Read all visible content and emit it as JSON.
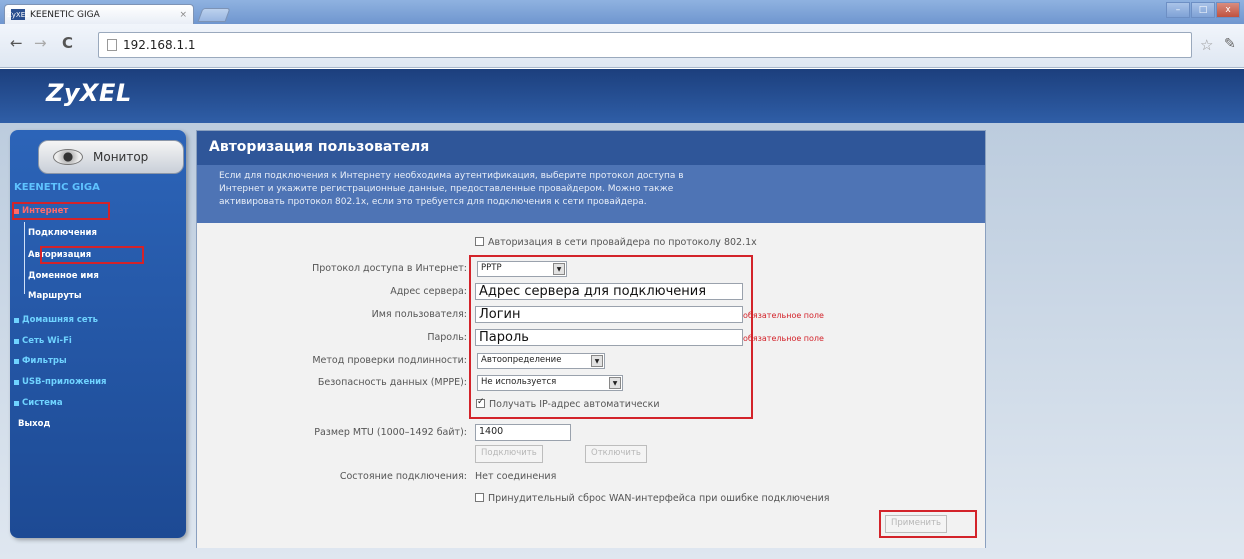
{
  "browser": {
    "tab_title": "KEENETIC GIGA",
    "tab_favicon": "ZyXEL",
    "tab_close": "×",
    "address": "192.168.1.1",
    "win_minimize": "–",
    "win_maximize": "□",
    "win_close": "x"
  },
  "router": {
    "logo": "ZyXEL",
    "monitor_label": "Монитор",
    "device_title": "KEENETIC GIGA",
    "menu": {
      "internet": "Интернет",
      "sub": [
        "Подключения",
        "Авторизация",
        "Доменное имя",
        "Маршруты"
      ],
      "home_network": "Домашняя сеть",
      "wifi": "Сеть Wi-Fi",
      "filters": "Фильтры",
      "usb": "USB-приложения",
      "system": "Система",
      "exit": "Выход"
    }
  },
  "content": {
    "title": "Авторизация пользователя",
    "description": [
      "Если для подключения к Интернету необходима аутентификация, выберите протокол доступа в",
      "Интернет и укажите регистрационные данные, предоставленные провайдером. Можно также",
      "активировать протокол 802.1x, если это требуется для подключения к сети провайдера."
    ],
    "checkbox_8021x": "Авторизация в сети провайдера по протоколу 802.1x",
    "fields": {
      "protocol_label": "Протокол доступа в Интернет:",
      "protocol_value": "PPTP",
      "server_label": "Адрес сервера:",
      "server_value": "Адрес сервера для подключения",
      "username_label": "Имя пользователя:",
      "username_value": "Логин",
      "password_label": "Пароль:",
      "password_value": "Пароль",
      "required_note": "обязательное поле",
      "auth_method_label": "Метод проверки подлинности:",
      "auth_method_value": "Автоопределение",
      "security_label": "Безопасность данных (MPPE):",
      "security_value": "Не используется",
      "auto_ip": "Получать IP-адрес автоматически",
      "mtu_label": "Размер MTU (1000–1492 байт):",
      "mtu_value": "1400",
      "connect_button": "Подключить",
      "disconnect_button": "Отключить",
      "status_label": "Состояние подключения:",
      "status_value": "Нет соединения",
      "force_reset": "Принудительный сброс WAN-интерфейса при ошибке подключения",
      "apply_button": "Применить"
    }
  },
  "colors": {
    "header_bg": "#1c3f7d",
    "sidebar_bg": "#2c64b8",
    "highlight": "#d3232a",
    "menu_link": "#6fd3ff"
  }
}
